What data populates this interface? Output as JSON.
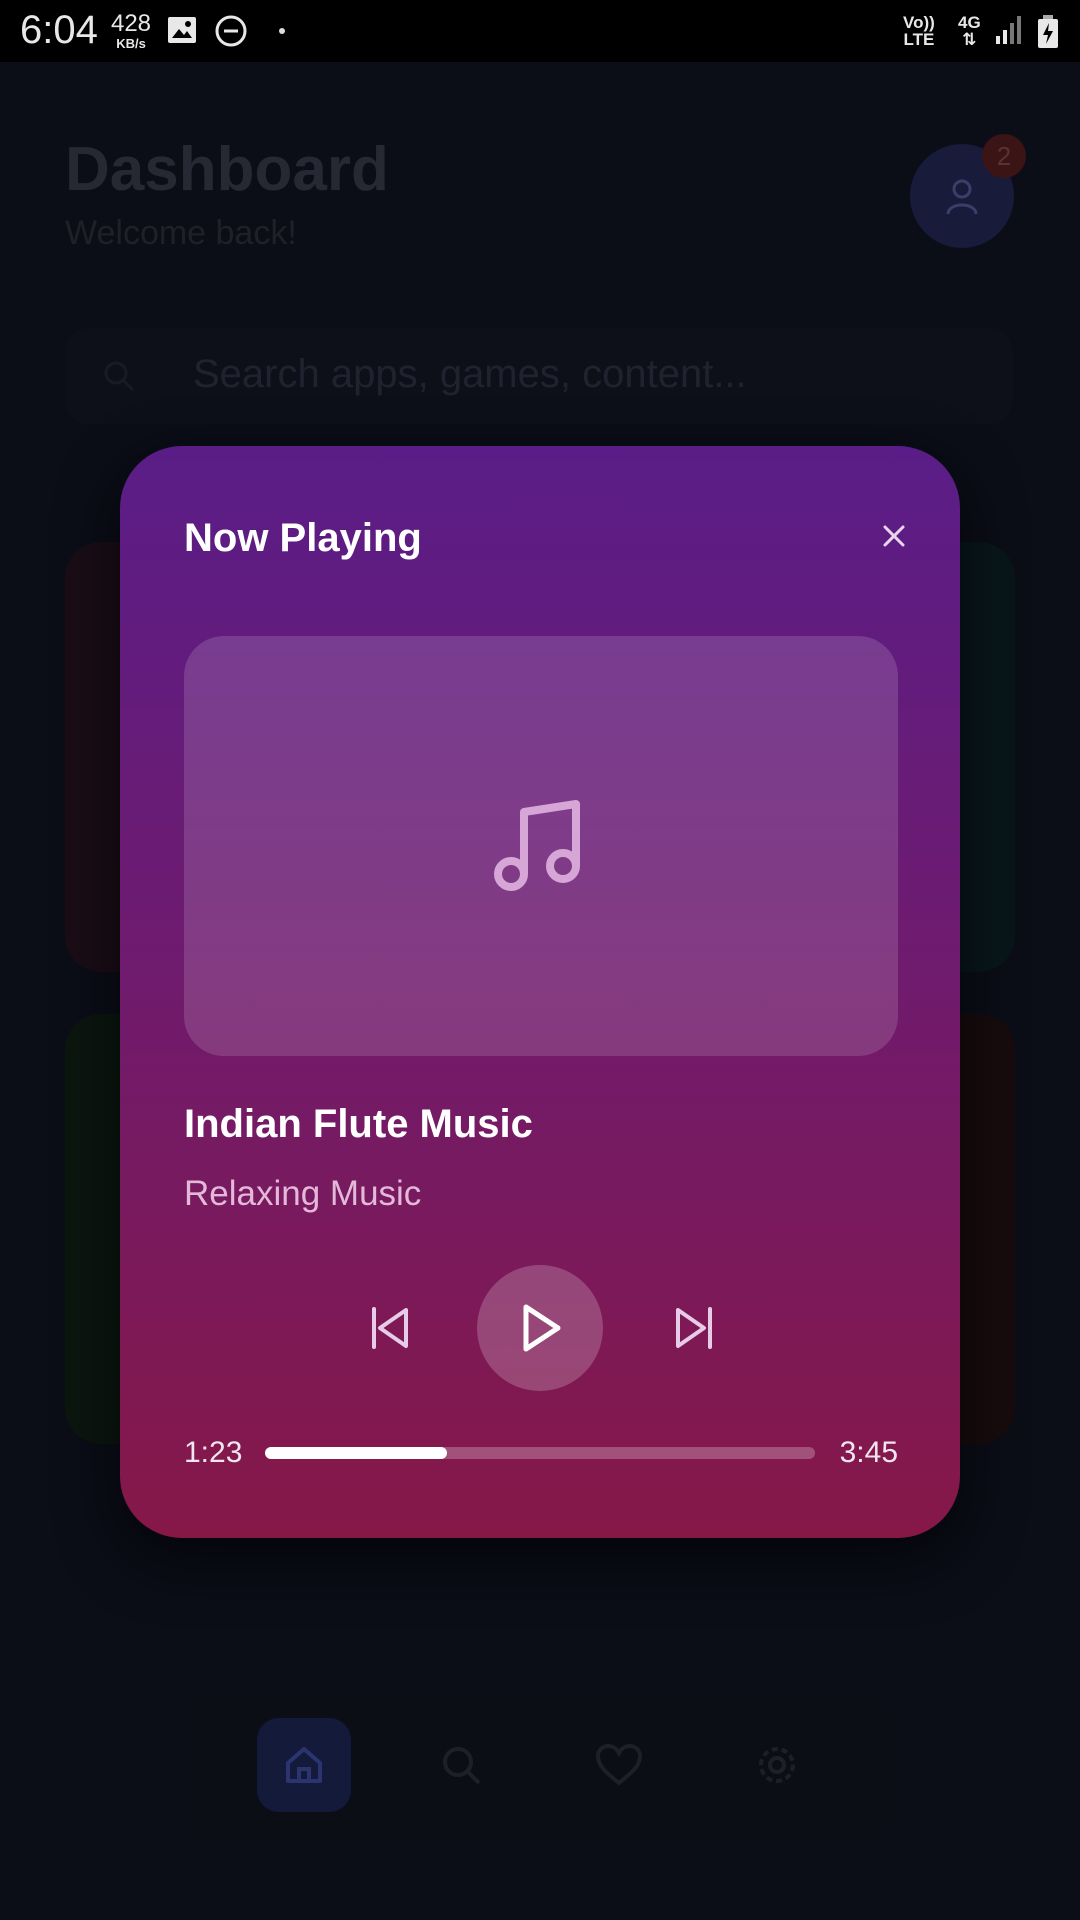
{
  "status_bar": {
    "time": "6:04",
    "net_speed_value": "428",
    "net_speed_unit": "KB/s",
    "volte_top": "Vo))",
    "volte_bottom": "LTE",
    "network": "4G"
  },
  "background": {
    "title": "Dashboard",
    "subtitle": "Welcome back!",
    "notification_count": "2",
    "search_placeholder": "Search apps, games, content..."
  },
  "player": {
    "title": "Now Playing",
    "track_title": "Indian Flute Music",
    "track_artist": "Relaxing Music",
    "current_time": "1:23",
    "total_time": "3:45",
    "progress": 0.33
  },
  "colors": {
    "modal_top": "#5a1d87",
    "modal_bottom": "#861848",
    "artist_text": "#e3b8d8"
  },
  "icons": {
    "close": "close-icon",
    "artwork": "music-note-icon",
    "previous": "skip-previous-icon",
    "play": "play-icon",
    "next": "skip-next-icon"
  }
}
